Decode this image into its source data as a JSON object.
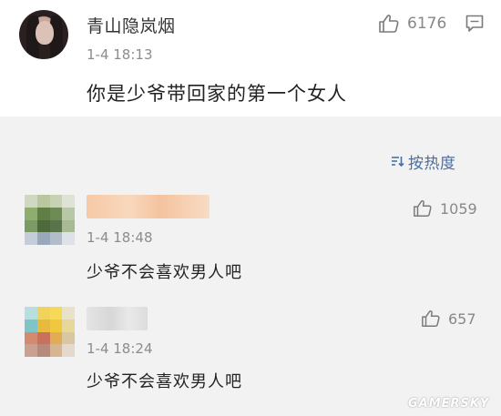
{
  "main_comment": {
    "username": "青山隐岚烟",
    "time": "1-4 18:13",
    "content": "你是少爷带回家的第一个女人",
    "like_count": "6176",
    "icons": {
      "like": "thumbs-up-icon",
      "reply": "comment-reply-icon"
    }
  },
  "sort": {
    "label": "按热度",
    "icon": "sort-icon"
  },
  "replies": [
    {
      "time": "1-4 18:48",
      "content": "少爷不会喜欢男人吧",
      "like_count": "1059"
    },
    {
      "time": "1-4 18:24",
      "content": "少爷不会喜欢男人吧",
      "like_count": "657"
    }
  ],
  "watermark": "GAMERSKY",
  "colors": {
    "page_background": "#f2f2f2",
    "card_background": "#ffffff",
    "sort_accent": "#4a6fa5",
    "muted_text": "#8c8c8c"
  }
}
